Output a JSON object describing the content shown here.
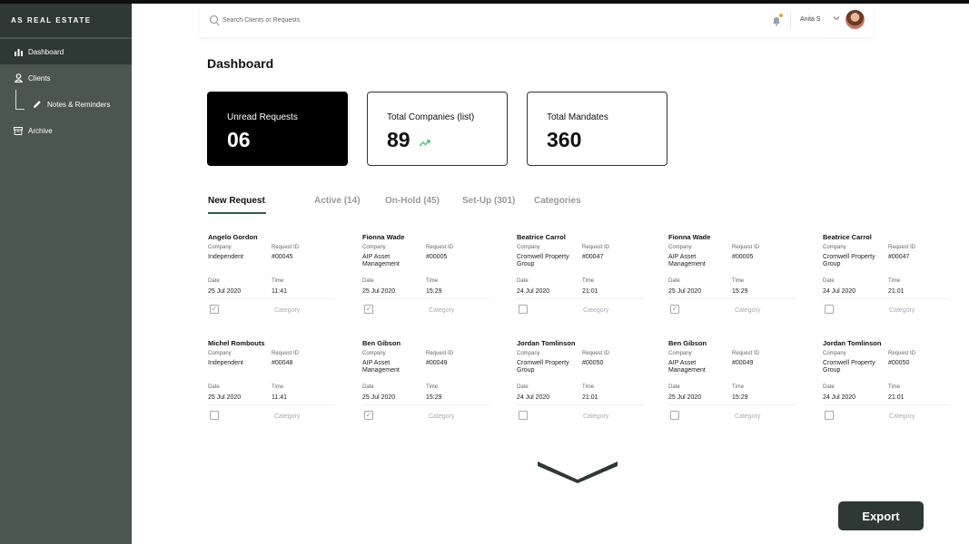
{
  "brand": {
    "title": "AS REAL ESTATE"
  },
  "sidebar": {
    "items": [
      {
        "label": "Dashboard",
        "icon": "bar-chart-icon"
      },
      {
        "label": "Clients",
        "icon": "user-icon"
      },
      {
        "label": "Notes & Reminders",
        "icon": "pencil-icon"
      },
      {
        "label": "Archive",
        "icon": "archive-box-icon"
      }
    ]
  },
  "header": {
    "search_placeholder": "Search Clients or Requests",
    "user_name": "Anita S"
  },
  "page": {
    "title": "Dashboard"
  },
  "stats": [
    {
      "label": "Unread Requests",
      "value": "06"
    },
    {
      "label": "Total Companies (list)",
      "value": "89"
    },
    {
      "label": "Total Mandates",
      "value": "360"
    }
  ],
  "tabs": [
    {
      "label": "New Request"
    },
    {
      "label": "Active (14)"
    },
    {
      "label": "On-Hold (45)"
    },
    {
      "label": "Set-Up (301)"
    },
    {
      "label": "Categories"
    }
  ],
  "labels": {
    "company": "Company",
    "request_id": "Request ID",
    "date": "Date",
    "time": "Time",
    "category": "Category"
  },
  "requests": [
    {
      "name": "Angelo Gordon",
      "company": "Independent",
      "request_id": "#00045",
      "date": "25 Jul 2020",
      "time": "11:41",
      "checked": true
    },
    {
      "name": "Fionna Wade",
      "company": "AIP Asset Management",
      "request_id": "#00005",
      "date": "25 Jul 2020",
      "time": "15:29",
      "checked": true
    },
    {
      "name": "Beatrice Carrol",
      "company": "Cromwell Property Group",
      "request_id": "#00047",
      "date": "24 Jul 2020",
      "time": "21:01",
      "checked": false
    },
    {
      "name": "Fionna Wade",
      "company": "AIP Asset Management",
      "request_id": "#00005",
      "date": "25 Jul 2020",
      "time": "15:29",
      "checked": true
    },
    {
      "name": "Beatrice Carrol",
      "company": "Cromwell Property Group",
      "request_id": "#00047",
      "date": "24 Jul 2020",
      "time": "21:01",
      "checked": false
    },
    {
      "name": "Michel Rombouts",
      "company": "Independent",
      "request_id": "#00048",
      "date": "25 Jul 2020",
      "time": "11:41",
      "checked": false
    },
    {
      "name": "Ben Gibson",
      "company": "AIP Asset Management",
      "request_id": "#00049",
      "date": "25 Jul 2020",
      "time": "15:29",
      "checked": true
    },
    {
      "name": "Jordan Tomlinson",
      "company": "Cromwell Property Group",
      "request_id": "#00050",
      "date": "24 Jul 2020",
      "time": "21:01",
      "checked": false
    },
    {
      "name": "Ben Gibson",
      "company": "AIP Asset Management",
      "request_id": "#00049",
      "date": "25 Jul 2020",
      "time": "15:29",
      "checked": false
    },
    {
      "name": "Jordan Tomlinson",
      "company": "Cromwell Property Group",
      "request_id": "#00050",
      "date": "24 Jul 2020",
      "time": "21:01",
      "checked": false
    }
  ],
  "export": {
    "label": "Export"
  },
  "colors": {
    "sidebar": "#4b5651",
    "sidebar_dark": "#2e3834",
    "accent": "#2e5d45",
    "trend": "#3cc46a"
  }
}
